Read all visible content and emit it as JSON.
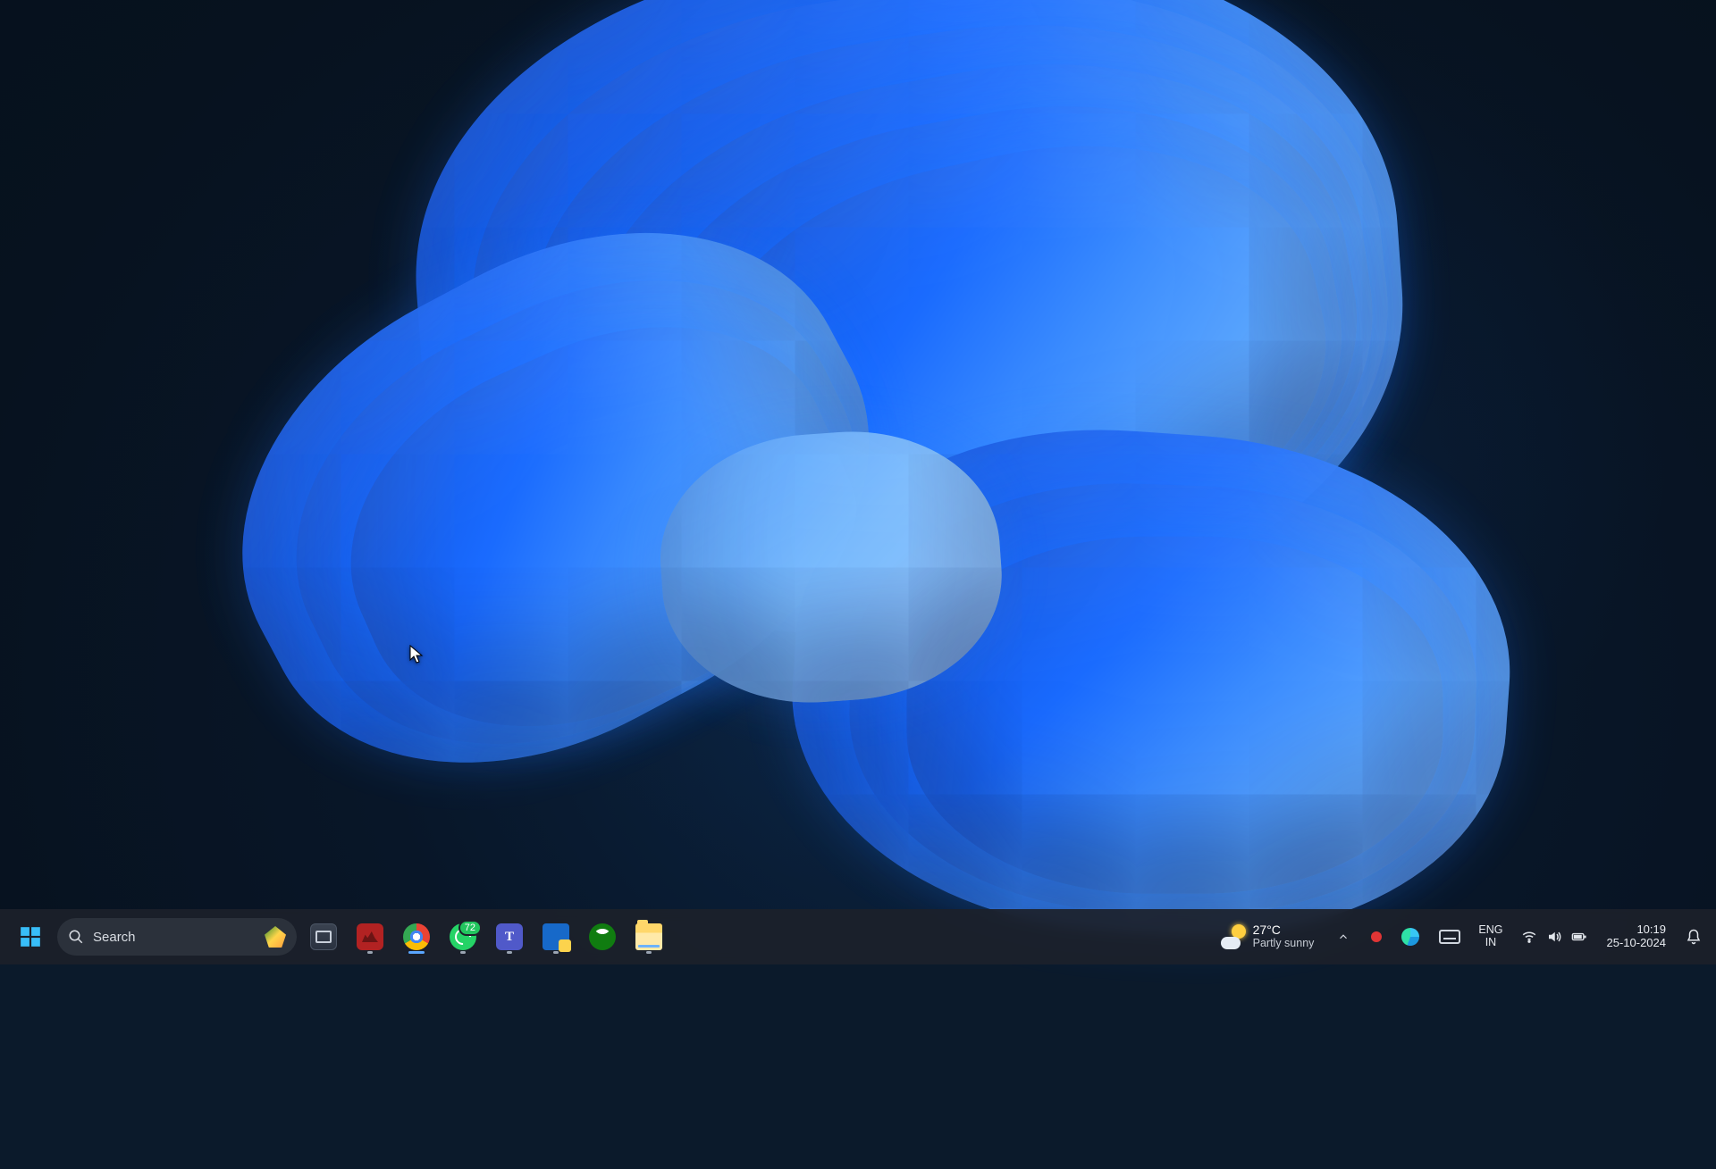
{
  "search": {
    "placeholder": "Search"
  },
  "taskbar_apps": {
    "whatsapp_badge": "72"
  },
  "weather": {
    "temperature": "27°C",
    "condition": "Partly sunny"
  },
  "language": {
    "lang": "ENG",
    "region": "IN"
  },
  "clock": {
    "time": "10:19",
    "date": "25-10-2024"
  }
}
